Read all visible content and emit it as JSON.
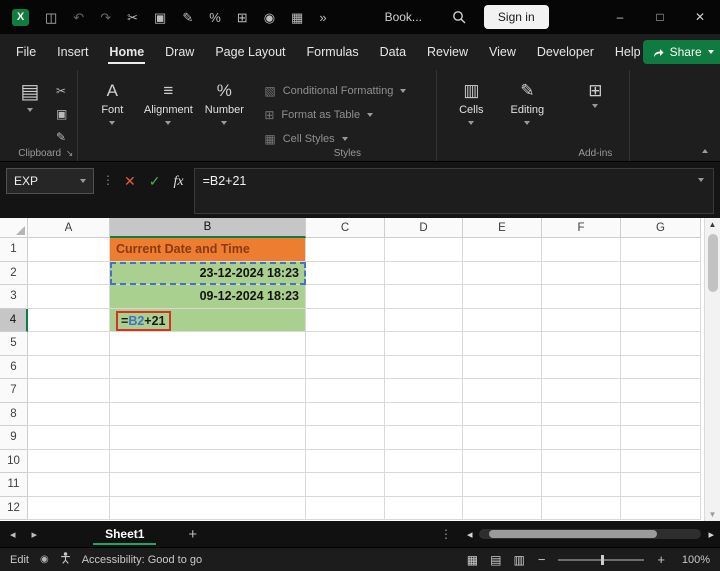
{
  "title_bar": {
    "icons": [
      {
        "name": "excel-logo-icon",
        "glyph": "X",
        "accent": true
      },
      {
        "name": "save-icon",
        "glyph": "◫"
      },
      {
        "name": "undo-icon",
        "glyph": "↶",
        "dim": true
      },
      {
        "name": "redo-icon",
        "glyph": "↷",
        "dim": true
      },
      {
        "name": "cut-icon",
        "glyph": "✂"
      },
      {
        "name": "copy-icon",
        "glyph": "▣"
      },
      {
        "name": "format-painter-icon",
        "glyph": "✎"
      },
      {
        "name": "percent-style-icon",
        "glyph": "%"
      },
      {
        "name": "borders-icon",
        "glyph": "⊞"
      },
      {
        "name": "camera-icon",
        "glyph": "◉"
      },
      {
        "name": "table-icon",
        "glyph": "▦"
      },
      {
        "name": "more-commands-icon",
        "glyph": "»"
      }
    ],
    "document_name": "Book...",
    "sign_in_label": "Sign in",
    "window_controls": [
      {
        "name": "minimize-button",
        "glyph": "–"
      },
      {
        "name": "maximize-button",
        "glyph": "□"
      },
      {
        "name": "close-button",
        "glyph": "✕"
      }
    ]
  },
  "menu": {
    "items": [
      "File",
      "Insert",
      "Home",
      "Draw",
      "Page Layout",
      "Formulas",
      "Data",
      "Review",
      "View",
      "Developer",
      "Help"
    ],
    "active": "Home",
    "share_label": "Share"
  },
  "ribbon": {
    "clipboard_group": {
      "label": "Clipboard",
      "paste_glyph": "▤",
      "launcher_glyph": "↘",
      "small_icons": [
        {
          "name": "cut-icon",
          "glyph": "✂"
        },
        {
          "name": "copy-icon",
          "glyph": "▣"
        },
        {
          "name": "format-painter-icon",
          "glyph": "✎"
        }
      ]
    },
    "left_buttons": [
      {
        "name": "font-button",
        "icon": "font-icon",
        "glyph": "A",
        "label": "Font"
      },
      {
        "name": "alignment-button",
        "icon": "alignment-icon",
        "glyph": "≡",
        "label": "Alignment"
      },
      {
        "name": "number-button",
        "icon": "number-icon",
        "glyph": "%",
        "label": "Number"
      }
    ],
    "styles_group": {
      "label": "Styles",
      "items": [
        {
          "name": "conditional-formatting-button",
          "icon": "conditional-formatting-icon",
          "glyph": "▧",
          "label": "Conditional Formatting"
        },
        {
          "name": "format-as-table-button",
          "icon": "format-as-table-icon",
          "glyph": "⊞",
          "label": "Format as Table"
        },
        {
          "name": "cell-styles-button",
          "icon": "cell-styles-icon",
          "glyph": "▦",
          "label": "Cell Styles"
        }
      ]
    },
    "right_buttons": [
      {
        "name": "cells-button",
        "icon": "cells-icon",
        "glyph": "▥",
        "label": "Cells"
      },
      {
        "name": "editing-button",
        "icon": "editing-icon",
        "glyph": "✎",
        "label": "Editing"
      }
    ],
    "addins_group": {
      "label": "Add-ins",
      "button_glyph": "⊞"
    }
  },
  "formula_bar": {
    "name_box": "EXP",
    "handle_glyph": "⋮",
    "cancel_glyph": "✕",
    "enter_glyph": "✓",
    "fx_label": "fx",
    "formula": "=B2+21"
  },
  "grid": {
    "columns": [
      "A",
      "B",
      "C",
      "D",
      "E",
      "F",
      "G"
    ],
    "row_numbers": [
      "1",
      "2",
      "3",
      "4",
      "5",
      "6",
      "7",
      "8",
      "9",
      "10",
      "11",
      "12"
    ],
    "selected_column": "B",
    "selected_row": "4",
    "cells": {
      "B1": {
        "text": "Current Date and Time",
        "fill": "#ED7D31",
        "color": "#8B3A0F",
        "bold": true,
        "align": "left"
      },
      "B2": {
        "text": "23-12-2024 18:23",
        "fill": "#A9D08E",
        "bold": true,
        "align": "right",
        "border": "#4472C4",
        "border_style": "dashed"
      },
      "B3": {
        "text": "09-12-2024 18:23",
        "fill": "#A9D08E",
        "bold": true,
        "align": "right"
      },
      "B4": {
        "fill": "#A9D08E",
        "align": "left",
        "annotation": "#D93025",
        "parts": [
          {
            "text": "=",
            "color": "#1a1a1a"
          },
          {
            "text": "B2",
            "color": "#4472C4"
          },
          {
            "text": "+21",
            "color": "#1a1a1a"
          }
        ]
      }
    },
    "scroll_up_glyph": "▲",
    "scroll_down_glyph": "▼"
  },
  "sheet_bar": {
    "prev_glyph": "◂",
    "next_glyph": "▸",
    "active_tab": "Sheet1",
    "add_label": "+",
    "menu_glyph": "⋮",
    "hscroll_left": "◂",
    "hscroll_right": "▸"
  },
  "status_bar": {
    "mode": "Edit",
    "macro_glyph": "◉",
    "accessibility": "Accessibility: Good to go",
    "view_icons": [
      {
        "name": "normal-view-icon",
        "glyph": "▦"
      },
      {
        "name": "page-layout-view-icon",
        "glyph": "▤"
      },
      {
        "name": "page-break-view-icon",
        "glyph": "▥"
      }
    ],
    "zoom_out": "−",
    "zoom_in": "+",
    "zoom": "100%"
  }
}
